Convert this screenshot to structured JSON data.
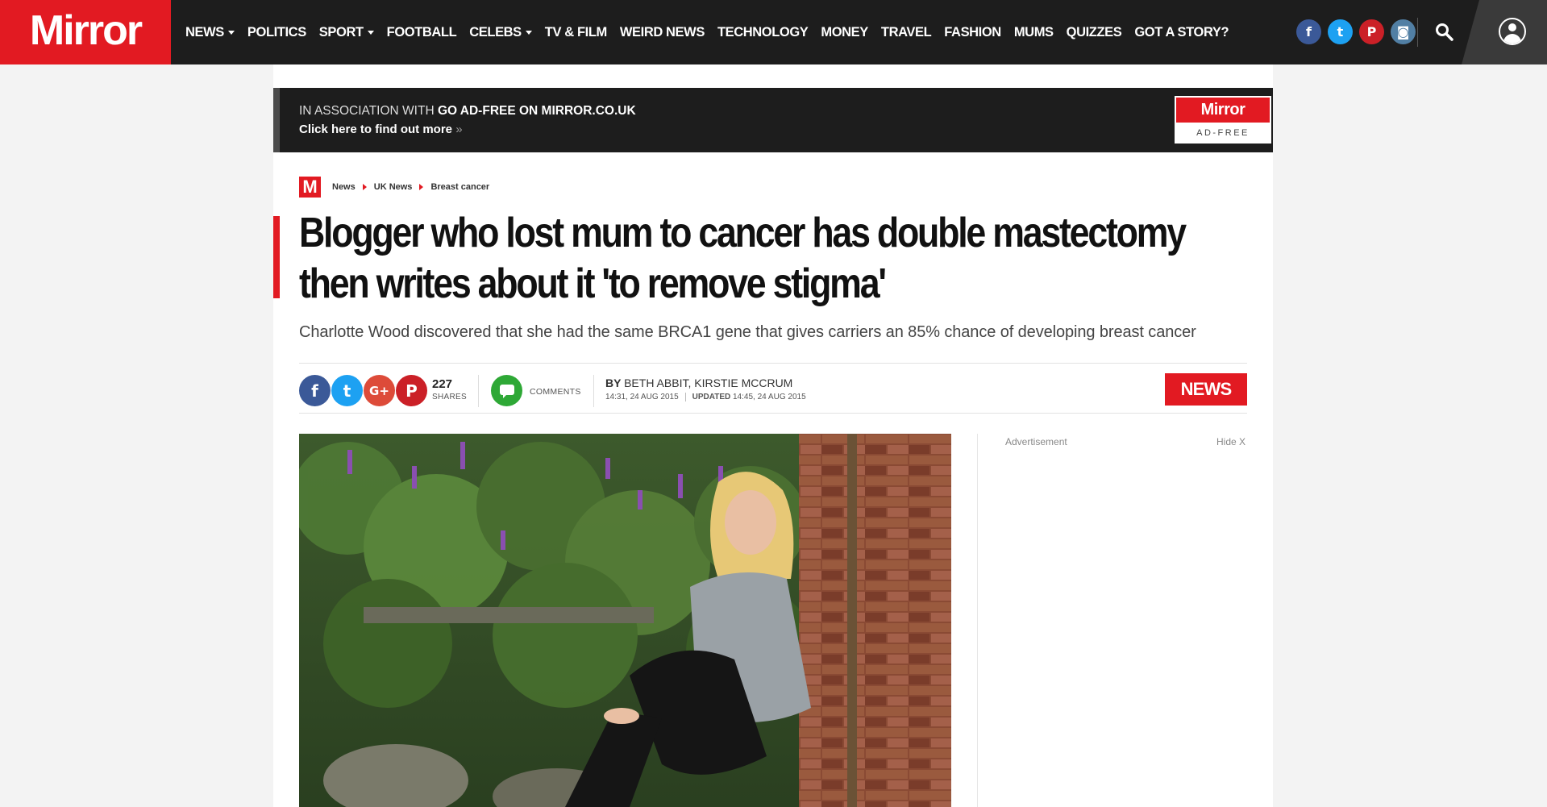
{
  "header": {
    "logo": "Mirror",
    "nav": [
      {
        "label": "NEWS",
        "dropdown": true
      },
      {
        "label": "POLITICS",
        "dropdown": false
      },
      {
        "label": "SPORT",
        "dropdown": true
      },
      {
        "label": "FOOTBALL",
        "dropdown": false
      },
      {
        "label": "CELEBS",
        "dropdown": true
      },
      {
        "label": "TV & FILM",
        "dropdown": false
      },
      {
        "label": "WEIRD NEWS",
        "dropdown": false
      },
      {
        "label": "TECHNOLOGY",
        "dropdown": false
      },
      {
        "label": "MONEY",
        "dropdown": false
      },
      {
        "label": "TRAVEL",
        "dropdown": false
      },
      {
        "label": "FASHION",
        "dropdown": false
      },
      {
        "label": "MUMS",
        "dropdown": false
      },
      {
        "label": "QUIZZES",
        "dropdown": false
      },
      {
        "label": "GOT A STORY?",
        "dropdown": false
      }
    ],
    "social": [
      {
        "name": "facebook-icon",
        "glyph": "f",
        "color": "#3b5998"
      },
      {
        "name": "twitter-icon",
        "glyph": "t",
        "color": "#1da1f2"
      },
      {
        "name": "pinterest-icon",
        "glyph": "P",
        "color": "#cb2027"
      },
      {
        "name": "instagram-icon",
        "glyph": "◙",
        "color": "#517fa4"
      }
    ]
  },
  "ad_banner": {
    "prefix": "IN ASSOCIATION WITH ",
    "headline": "GO AD-FREE ON MIRROR.CO.UK",
    "cta": "Click here to find out more",
    "cta_arrow": "»",
    "badge_top": "Mirror",
    "badge_bottom": "AD-FREE"
  },
  "breadcrumb": {
    "logo": "M",
    "items": [
      "News",
      "UK News",
      "Breast cancer"
    ]
  },
  "article": {
    "headline_line1": "Blogger who lost mum to cancer has double mastectomy",
    "headline_line2": "then writes about it 'to remove stigma'",
    "standfirst": "Charlotte Wood discovered that she had the same BRCA1 gene that gives carriers an 85% chance of developing breast cancer",
    "share_count": "227",
    "share_label": "SHARES",
    "comments_label": "COMMENTS",
    "byline_prefix": "BY ",
    "byline_authors": "BETH ABBIT, KIRSTIE MCCRUM",
    "published": "14:31, 24 AUG 2015",
    "updated_label": "UPDATED",
    "updated": "14:45, 24 AUG 2015",
    "section_tag": "NEWS"
  },
  "share_buttons": [
    {
      "name": "facebook-share-icon",
      "glyph": "f",
      "color": "#3b5998"
    },
    {
      "name": "twitter-share-icon",
      "glyph": "t",
      "color": "#1da1f2"
    },
    {
      "name": "googleplus-share-icon",
      "glyph": "G+",
      "color": "#dd4b39"
    },
    {
      "name": "pinterest-share-icon",
      "glyph": "P",
      "color": "#cb2027"
    }
  ],
  "sidebar": {
    "ad_label": "Advertisement",
    "hide_label": "Hide X"
  },
  "colors": {
    "brand_red": "#e21a22",
    "nav_bg": "#1d1d1d"
  }
}
